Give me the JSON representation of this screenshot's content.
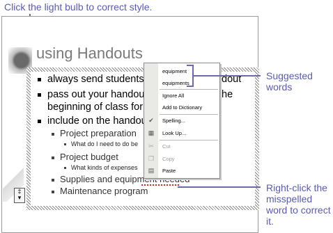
{
  "callouts": {
    "top": "Click the light bulb to correct style.",
    "suggested": "Suggested words",
    "right_click": "Right-click the misspelled word to correct it."
  },
  "slide": {
    "title": "using Handouts",
    "bullets": [
      "always send students",
      "pass out your handout",
      "beginning of class for",
      "include on the handou"
    ],
    "bullet_suffixes": [
      "dout",
      "he"
    ],
    "sub_bullets": [
      "Project preparation",
      "Project budget",
      "Supplies and equipment needed",
      "Maintenance program"
    ],
    "sub_sub_bullets": [
      "What do I need to do be",
      "What kinds of expenses"
    ]
  },
  "context_menu": {
    "suggestions": [
      "equipment",
      "equipments"
    ],
    "items": [
      {
        "label": "Ignore All",
        "enabled": true
      },
      {
        "label": "Add to Dictionary",
        "enabled": true
      },
      {
        "label": "Spelling...",
        "enabled": true,
        "icon": "spelling-icon"
      },
      {
        "label": "Look Up...",
        "enabled": true,
        "icon": "lookup-icon"
      },
      {
        "label": "Cut",
        "enabled": false,
        "icon": "cut-icon"
      },
      {
        "label": "Copy",
        "enabled": false,
        "icon": "copy-icon"
      },
      {
        "label": "Paste",
        "enabled": true,
        "icon": "paste-icon"
      }
    ]
  },
  "colors": {
    "callout": "#5a5ab4",
    "bracket": "#6a6aaa"
  }
}
